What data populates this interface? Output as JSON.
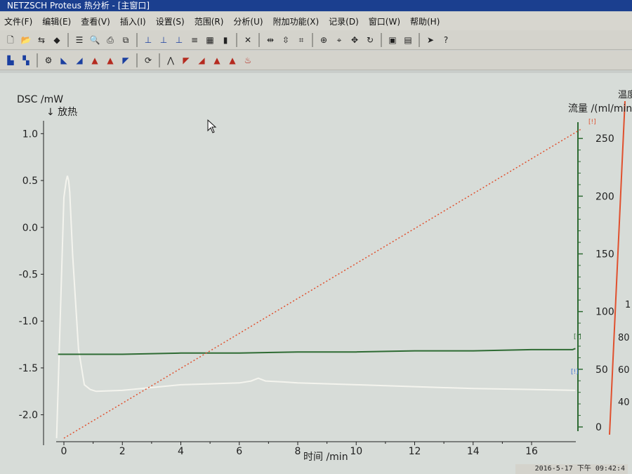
{
  "window": {
    "title": "NETZSCH Proteus 热分析 - [主窗口]"
  },
  "menu": {
    "items": [
      "文件(F)",
      "编辑(E)",
      "查看(V)",
      "插入(I)",
      "设置(S)",
      "范围(R)",
      "分析(U)",
      "附加功能(X)",
      "记录(D)",
      "窗口(W)",
      "帮助(H)"
    ]
  },
  "toolbar1": {
    "icons": [
      "new-file-icon",
      "open-folder-icon",
      "import-icon",
      "layers-icon",
      "sep",
      "list-icon",
      "print-preview-icon",
      "print-icon",
      "copy-icon",
      "sep",
      "peak-1-icon",
      "peak-2-icon",
      "peak-3-icon",
      "legend-icon",
      "grid-icon",
      "bars-icon",
      "sep",
      "close-x-icon",
      "sep",
      "zoom-x-icon",
      "zoom-y-icon",
      "zoom-fit-icon",
      "sep",
      "zoom-in-icon",
      "zoom-area-icon",
      "move-icon",
      "refresh-icon",
      "sep",
      "export-icon",
      "snapshot-icon",
      "sep",
      "pointer-icon",
      "help-cursor-icon"
    ]
  },
  "toolbar2": {
    "icons": [
      "dsc-icon",
      "tg-icon",
      "sep",
      "settings-gear-icon",
      "baseline-icon",
      "onset-icon",
      "peak-area-icon",
      "peak-icon",
      "integral-icon",
      "sep",
      "rotate-icon",
      "sep",
      "tangent-icon",
      "curve-1-icon",
      "curve-2-icon",
      "curve-3-icon",
      "curve-4-icon",
      "curve-5-icon"
    ]
  },
  "colors": {
    "plot_bg": "#d7dcd8",
    "dsc": "#f4f4ee",
    "flow": "#2e6b33",
    "temp": "#e0502e",
    "axis": "#1f1f1f"
  },
  "chart_data": {
    "type": "line",
    "title": "",
    "left_axis": {
      "label": "DSC /mW",
      "sublabel": "↓ 放热",
      "ylim": [
        -2.25,
        1.1
      ],
      "ticks": [
        1.0,
        0.5,
        0.0,
        -0.5,
        -1.0,
        -1.5,
        -2.0
      ],
      "tick_labels": [
        "1.0",
        "0.5",
        "0.0",
        "-0.5",
        "-1.0",
        "-1.5",
        "-2.0"
      ]
    },
    "flow_axis": {
      "label": "流量 /(ml/min)",
      "ylim": [
        0,
        255
      ],
      "ticks": [
        0,
        50,
        100,
        150,
        200,
        250
      ],
      "tick_labels": [
        "0",
        "50",
        "100",
        "150",
        "200",
        "250"
      ]
    },
    "temp_axis": {
      "label": "温度",
      "ticks": [
        40,
        60,
        80
      ],
      "tick_labels": [
        "40",
        "60",
        "80"
      ],
      "partial_label": "1"
    },
    "x_axis": {
      "label": "时间 /min",
      "xlim": [
        -0.2,
        17.8
      ],
      "ticks": [
        0,
        2,
        4,
        6,
        8,
        10,
        12,
        14,
        16
      ],
      "tick_labels": [
        "0",
        "2",
        "4",
        "6",
        "8",
        "10",
        "12",
        "14",
        "16"
      ]
    },
    "series": [
      {
        "key": "dsc",
        "style": "solid",
        "x": [
          -0.25,
          0.0,
          0.08,
          0.12,
          0.16,
          0.2,
          0.3,
          0.5,
          0.7,
          0.9,
          1.1,
          2,
          3,
          4,
          5,
          6,
          6.4,
          6.65,
          6.9,
          7.5,
          8,
          10,
          12,
          14,
          16,
          17.5
        ],
        "y": [
          -2.25,
          0.32,
          0.5,
          0.55,
          0.5,
          0.38,
          -0.3,
          -1.3,
          -1.68,
          -1.73,
          -1.75,
          -1.74,
          -1.71,
          -1.68,
          -1.67,
          -1.66,
          -1.64,
          -1.61,
          -1.64,
          -1.65,
          -1.66,
          -1.68,
          -1.7,
          -1.72,
          -1.73,
          -1.74
        ]
      },
      {
        "key": "flow",
        "style": "solid",
        "x": [
          -0.2,
          0,
          2,
          4,
          6,
          8,
          10,
          12,
          14,
          16,
          17.4,
          17.5
        ],
        "y": [
          63,
          63,
          63,
          64,
          64,
          65,
          65,
          66,
          66,
          67,
          67,
          68
        ]
      },
      {
        "key": "temp",
        "style": "dotted",
        "x": [
          0,
          17.7
        ],
        "y": [
          -2.25,
          1.05
        ]
      }
    ],
    "end_markers": [
      "[!]",
      "[!]",
      "[!]"
    ]
  },
  "status": {
    "datetime": "2016-5-17 下午 09:42:4"
  }
}
